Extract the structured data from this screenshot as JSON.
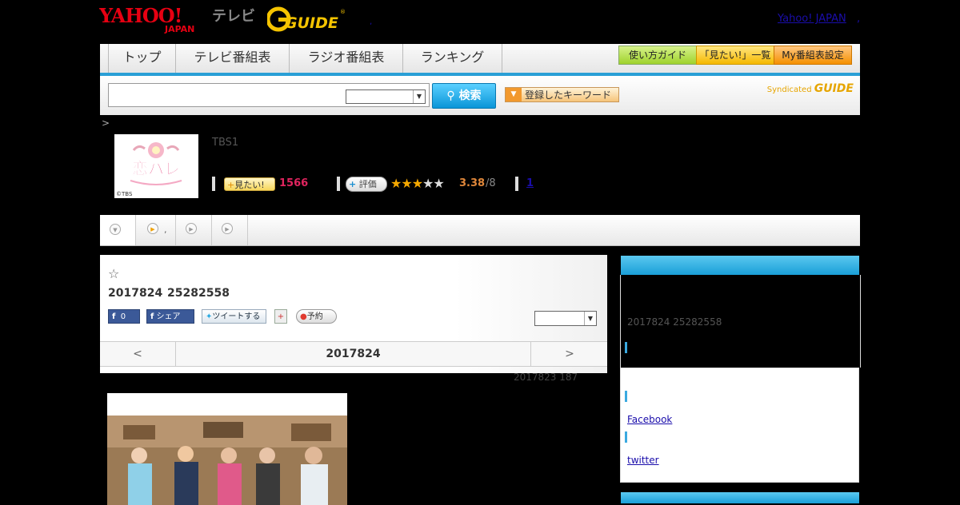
{
  "header": {
    "yahoo_logo": "YAHOO! JAPAN",
    "tv_label": "テレビ",
    "gguide_logo": "G GUIDE",
    "top_link": "Yahoo! JAPAN",
    "top_link_sep": ",",
    "logo_dot": ","
  },
  "nav": {
    "tabs": [
      "トップ",
      "テレビ番組表",
      "ラジオ番組表",
      "ランキング"
    ],
    "guide_btn": "使い方ガイド",
    "wish_btn": "「見たい!」一覧",
    "my_btn": "My番組表設定"
  },
  "search": {
    "input_value": "",
    "button_label": "検索",
    "keyword_btn": "登録したキーワード",
    "syndicated": "Syndicated",
    "syndicated_logo": "GUIDE"
  },
  "breadcrumb": ">",
  "program": {
    "thumb_text": "恋ハレ",
    "thumb_copyright": "©TBS",
    "channel": "TBS1",
    "mitai_label": "見たい!",
    "mitai_count": "1566",
    "hyoka_label": "評価",
    "stars": "★★★★★",
    "rating": "3.38",
    "rating_max": "/8",
    "comment_count": "1"
  },
  "tabstrip": {
    "tab2_dot": ","
  },
  "episode": {
    "fav_star": "☆",
    "air_date": "2017824",
    "air_time": "25282558",
    "fb_count": "0",
    "fb_share": "シェア",
    "tweet": "ツイートする",
    "reserve": "予約",
    "pager_prev": "<",
    "pager_date": "2017824",
    "pager_next": ">",
    "update_note": "2017823  187"
  },
  "sidebar": {
    "datetime": "2017824  25282558",
    "facebook_link": "Facebook",
    "twitter_link": "twitter"
  },
  "colors": {
    "accent_blue": "#2a9fd6",
    "mitai_pink": "#e0245e",
    "rating_orange": "#e0873a"
  }
}
